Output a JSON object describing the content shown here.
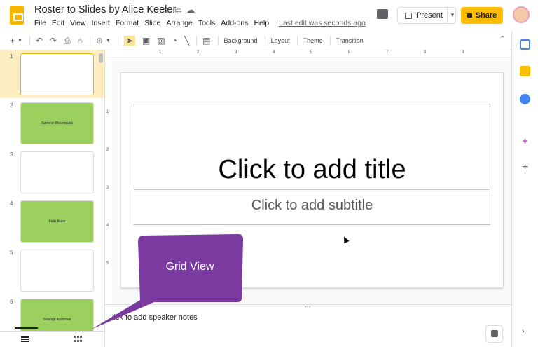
{
  "header": {
    "title": "Roster to Slides by Alice Keeler",
    "menu": [
      "File",
      "Edit",
      "View",
      "Insert",
      "Format",
      "Slide",
      "Arrange",
      "Tools",
      "Add-ons",
      "Help"
    ],
    "last_edit": "Last edit was seconds ago",
    "present_label": "Present",
    "share_label": "Share"
  },
  "toolbar": {
    "background_label": "Background",
    "layout_label": "Layout",
    "theme_label": "Theme",
    "transition_label": "Transition"
  },
  "filmstrip": {
    "slides": [
      {
        "num": "1",
        "text": "",
        "color": "#ffffff"
      },
      {
        "num": "2",
        "text": "Sammie Bloomquist",
        "color": "#9bd05f"
      },
      {
        "num": "3",
        "text": "",
        "color": "#ffffff"
      },
      {
        "num": "4",
        "text": "Felix Kous",
        "color": "#9bd05f"
      },
      {
        "num": "5",
        "text": "",
        "color": "#ffffff"
      },
      {
        "num": "6",
        "text": "Solange Ashbrook",
        "color": "#9bd05f"
      }
    ]
  },
  "rulers": {
    "horizontal": [
      "1",
      "2",
      "3",
      "4",
      "5",
      "6",
      "7",
      "8",
      "9"
    ],
    "vertical": [
      "1",
      "2",
      "3",
      "4",
      "5"
    ]
  },
  "slide": {
    "title_placeholder": "Click to add title",
    "subtitle_placeholder": "Click to add subtitle"
  },
  "notes": {
    "placeholder": "lick to add speaker notes"
  },
  "callout": {
    "label": "Grid View",
    "color": "#7b3aa0"
  }
}
